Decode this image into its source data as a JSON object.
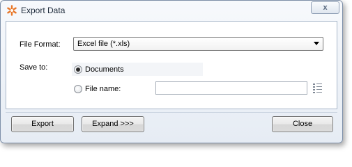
{
  "window": {
    "title": "Export Data",
    "close_glyph": "x",
    "app_icon": "orange-asterisk-icon"
  },
  "form": {
    "file_format_label": "File Format:",
    "file_format_value": "Excel file (*.xls)",
    "save_to_label": "Save to:",
    "option_documents_label": "Documents",
    "option_documents_selected": true,
    "option_filename_label": "File name:",
    "option_filename_selected": false,
    "filename_value": "",
    "browse_icon": "browse-folder-icon"
  },
  "buttons": {
    "export_label": "Export",
    "expand_label": "Expand >>>",
    "close_label": "Close"
  },
  "colors": {
    "app_icon": "#e8782a",
    "frame": "#7d8fa8"
  }
}
